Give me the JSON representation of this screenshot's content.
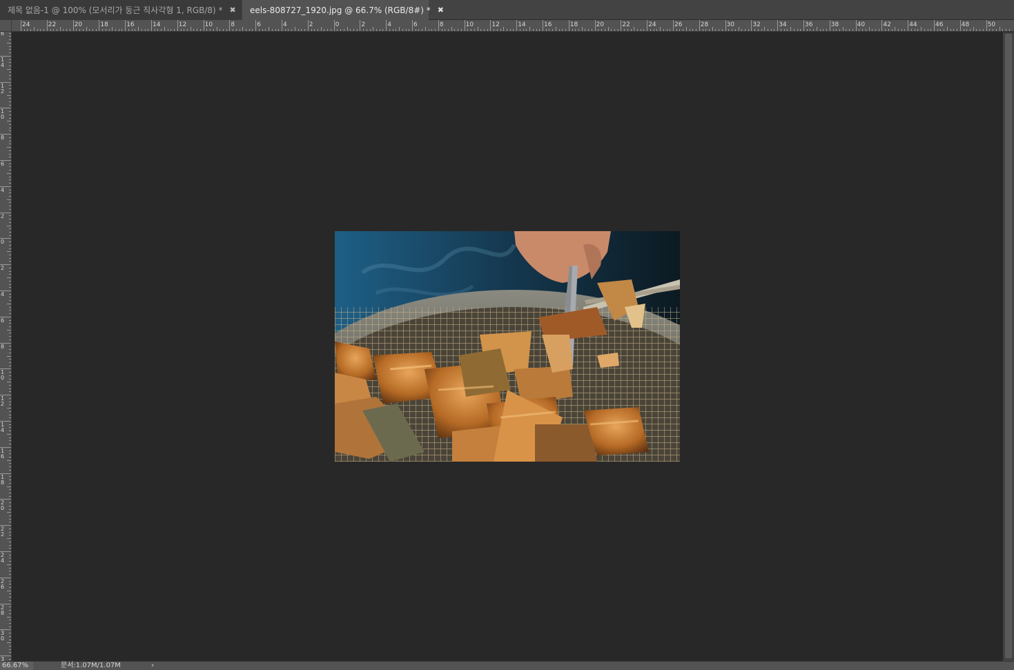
{
  "tabs": [
    {
      "label": "제목 없음-1 @ 100% (모서리가 둥근 직사각형  1, RGB/8) *",
      "close": "✖",
      "active": false
    },
    {
      "label": "eels-808727_1920.jpg @ 66.7% (RGB/8#) *",
      "close": "✖",
      "active": true
    }
  ],
  "ruler_h_labels": [
    "24",
    "22",
    "20",
    "18",
    "16",
    "14",
    "12",
    "10",
    "8",
    "6",
    "4",
    "2",
    "0",
    "2",
    "4",
    "6",
    "8",
    "10",
    "12",
    "14",
    "16",
    "18",
    "20",
    "22",
    "24",
    "26",
    "28",
    "30",
    "32",
    "34",
    "36",
    "38",
    "40",
    "42",
    "44",
    "46",
    "48",
    "50"
  ],
  "ruler_v_labels": [
    "6",
    "14",
    "12",
    "10",
    "8",
    "6",
    "4",
    "2",
    "0",
    "2",
    "4",
    "6",
    "8",
    "10",
    "12",
    "14",
    "16",
    "18",
    "20",
    "22",
    "24",
    "26",
    "28",
    "30",
    "3"
  ],
  "canvas": {
    "image_name": "eels-808727_1920.jpg",
    "image_description_icon": "photo-grilled-eel"
  },
  "status": {
    "zoom": "66.67%",
    "doc_info": "문서:1.07M/1.07M",
    "arrow": "›"
  },
  "colors": {
    "pasteboard": "#282828",
    "ruler": "#535353",
    "tab_active": "#535353",
    "tab_inactive": "#3a3a3a"
  }
}
